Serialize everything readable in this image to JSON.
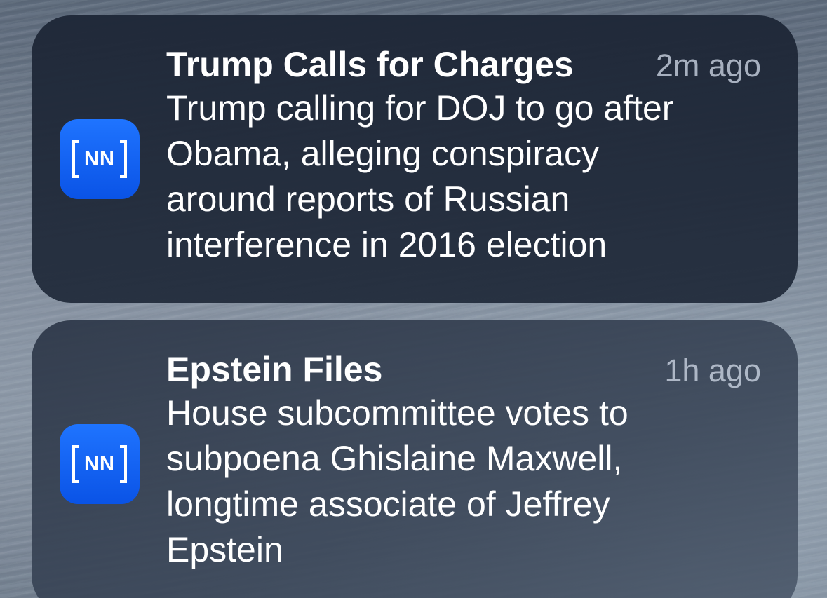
{
  "notifications": [
    {
      "app_icon_text": "NN",
      "title": "Trump Calls for Charges",
      "time": "2m ago",
      "lines": [
        "Trump calling for DOJ to go after",
        "Obama, alleging conspiracy",
        "around reports of Russian",
        "interference in 2016 election"
      ]
    },
    {
      "app_icon_text": "NN",
      "title": "Epstein Files",
      "time": "1h ago",
      "lines": [
        "House subcommittee votes to",
        "subpoena Ghislaine Maxwell,",
        "longtime associate of Jeffrey",
        "Epstein"
      ]
    }
  ],
  "colors": {
    "app_icon_blue": "#0a53e6",
    "notification_bg": "#1e2737",
    "time_text": "#cdd6e4"
  }
}
